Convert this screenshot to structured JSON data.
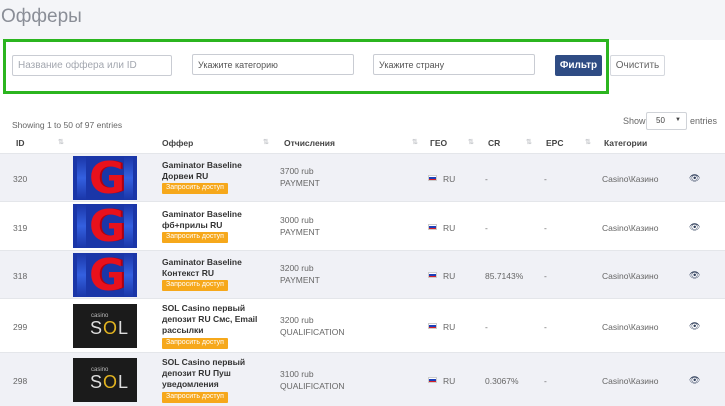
{
  "page": {
    "title": "Офферы"
  },
  "filters": {
    "name_placeholder": "Название оффера или ID",
    "category_placeholder": "Укажите категорию",
    "country_placeholder": "Укажите страну",
    "filter_label": "Фильтр",
    "clear_label": "Очистить",
    "highlight_color": "#2bb51f"
  },
  "table_info": {
    "showing": "Showing 1 to 50 of 97 entries",
    "show_label": "Show",
    "page_length": "50",
    "entries_label": "entries"
  },
  "columns": [
    "ID",
    "Оффер",
    "Отчисления",
    "ГЕО",
    "CR",
    "EPC",
    "Категории"
  ],
  "request_label": "Запросить доступ",
  "rows": [
    {
      "id": "320",
      "logo": "gaminator-logo",
      "name": "Gaminator Baseline Дорвеи RU",
      "amount": "3700 rub",
      "payout_type": "PAYMENT",
      "geo": "RU",
      "cr": "-",
      "epc": "-",
      "category": "Casino\\Казино"
    },
    {
      "id": "319",
      "logo": "gaminator-logo",
      "name": "Gaminator Baseline фб+прилы RU",
      "amount": "3000 rub",
      "payout_type": "PAYMENT",
      "geo": "RU",
      "cr": "-",
      "epc": "-",
      "category": "Casino\\Казино"
    },
    {
      "id": "318",
      "logo": "gaminator-logo",
      "name": "Gaminator Baseline Контекст RU",
      "amount": "3200 rub",
      "payout_type": "PAYMENT",
      "geo": "RU",
      "cr": "85.7143%",
      "epc": "-",
      "category": "Casino\\Казино"
    },
    {
      "id": "299",
      "logo": "sol-casino-logo",
      "name": "SOL Casino первый депозит RU Смс, Email рассылки",
      "amount": "3200 rub",
      "payout_type": "QUALIFICATION",
      "geo": "RU",
      "cr": "-",
      "epc": "-",
      "category": "Casino\\Казино"
    },
    {
      "id": "298",
      "logo": "sol-casino-logo",
      "name": "SOL Casino первый депозит RU Пуш уведомления",
      "amount": "3100 rub",
      "payout_type": "QUALIFICATION",
      "geo": "RU",
      "cr": "0.3067%",
      "epc": "-",
      "category": "Casino\\Казино"
    }
  ],
  "logos": {
    "gaminator_letter": "G",
    "sol_small": "casino",
    "sol_s": "S",
    "sol_o": "O",
    "sol_l": "L"
  }
}
